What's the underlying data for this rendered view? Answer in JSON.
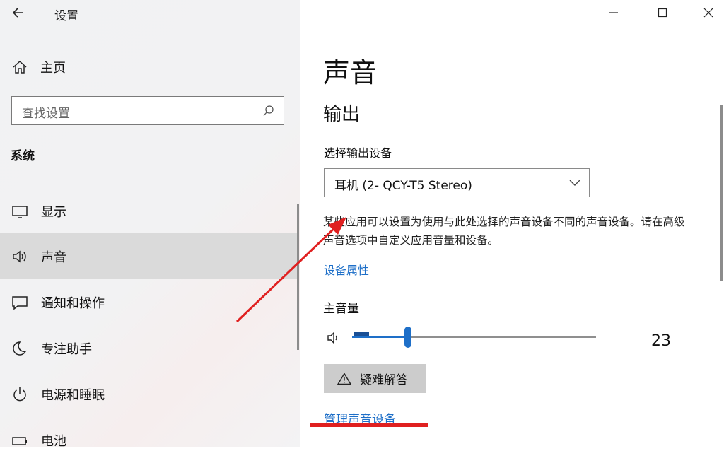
{
  "window": {
    "title": "设置",
    "minimize": "minimize",
    "maximize": "maximize",
    "close": "close"
  },
  "sidebar": {
    "home": "主页",
    "search_placeholder": "查找设置",
    "section": "系统",
    "items": [
      {
        "label": "显示",
        "icon": "monitor-icon",
        "active": false
      },
      {
        "label": "声音",
        "icon": "speaker-icon",
        "active": true
      },
      {
        "label": "通知和操作",
        "icon": "notification-icon",
        "active": false
      },
      {
        "label": "专注助手",
        "icon": "moon-icon",
        "active": false
      },
      {
        "label": "电源和睡眠",
        "icon": "power-icon",
        "active": false
      },
      {
        "label": "电池",
        "icon": "battery-icon",
        "active": false
      }
    ]
  },
  "main": {
    "title": "声音",
    "output_heading": "输出",
    "select_output_label": "选择输出设备",
    "output_device": "耳机 (2- QCY-T5 Stereo)",
    "description": "某些应用可以设置为使用与此处选择的声音设备不同的声音设备。请在高级声音选项中自定义应用音量和设备。",
    "device_properties_link": "设备属性",
    "master_volume_label": "主音量",
    "volume": 23,
    "troubleshoot_label": "疑难解答",
    "manage_devices_link": "管理声音设备"
  },
  "colors": {
    "accent": "#1e6fc8",
    "annotation": "#e02020",
    "sidebar_active": "#dadada"
  }
}
